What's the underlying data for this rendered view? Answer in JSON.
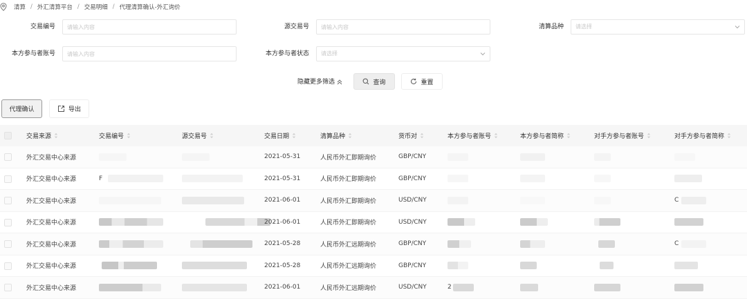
{
  "breadcrumb": [
    "清算",
    "外汇清算平台",
    "交易明细",
    "代理清算确认-外汇询价"
  ],
  "filters": {
    "trade_no": {
      "label": "交易编号",
      "placeholder": "请输入内容"
    },
    "source_trade_no": {
      "label": "源交易号",
      "placeholder": "请输入内容"
    },
    "clearing_product": {
      "label": "清算品种",
      "placeholder": "请选择"
    },
    "own_account": {
      "label": "本方参与者账号",
      "placeholder": "请输入内容"
    },
    "own_status": {
      "label": "本方参与者状态",
      "placeholder": "请选择"
    }
  },
  "actions": {
    "collapse_label": "隐藏更多筛选",
    "query_label": "查询",
    "reset_label": "重置",
    "agency_confirm_label": "代理确认",
    "export_label": "导出"
  },
  "table": {
    "columns": [
      "交易来源",
      "交易编号",
      "源交易号",
      "交易日期",
      "清算品种",
      "货币对",
      "本方参与者账号",
      "本方参与者简称",
      "对手方参与者账号",
      "对手方参与者简称"
    ],
    "rows": [
      {
        "source": "外汇交易中心来源",
        "trade_no": "",
        "source_trade_no": "",
        "date": "2021-05-31",
        "product": "人民币外汇即期询价",
        "pair": "GBP/CNY",
        "own_account": "",
        "own_name": "",
        "cp_account": "",
        "cp_name": ""
      },
      {
        "source": "外汇交易中心来源",
        "trade_no": "F",
        "source_trade_no": "",
        "date": "2021-05-31",
        "product": "人民币外汇即期询价",
        "pair": "GBP/CNY",
        "own_account": "",
        "own_name": "",
        "cp_account": "",
        "cp_name": ""
      },
      {
        "source": "外汇交易中心来源",
        "trade_no": "",
        "source_trade_no": "",
        "date": "2021-06-01",
        "product": "人民币外汇即期询价",
        "pair": "USD/CNY",
        "own_account": "",
        "own_name": "",
        "cp_account": "",
        "cp_name": "C"
      },
      {
        "source": "外汇交易中心来源",
        "trade_no": "",
        "source_trade_no": "",
        "date": "2021-06-01",
        "product": "人民币外汇即期询价",
        "pair": "USD/CNY",
        "own_account": "",
        "own_name": "",
        "cp_account": "",
        "cp_name": ""
      },
      {
        "source": "外汇交易中心来源",
        "trade_no": "",
        "source_trade_no": "",
        "date": "2021-05-28",
        "product": "人民币外汇远期询价",
        "pair": "GBP/CNY",
        "own_account": "",
        "own_name": "",
        "cp_account": "",
        "cp_name": "C"
      },
      {
        "source": "外汇交易中心来源",
        "trade_no": "",
        "source_trade_no": "",
        "date": "2021-05-28",
        "product": "人民币外汇远期询价",
        "pair": "GBP/CNY",
        "own_account": "",
        "own_name": "",
        "cp_account": "",
        "cp_name": ""
      },
      {
        "source": "外汇交易中心来源",
        "trade_no": "",
        "source_trade_no": "",
        "date": "2021-06-01",
        "product": "人民币外汇远期询价",
        "pair": "USD/CNY",
        "own_account": "2",
        "own_name": "",
        "cp_account": "",
        "cp_name": ""
      }
    ]
  }
}
